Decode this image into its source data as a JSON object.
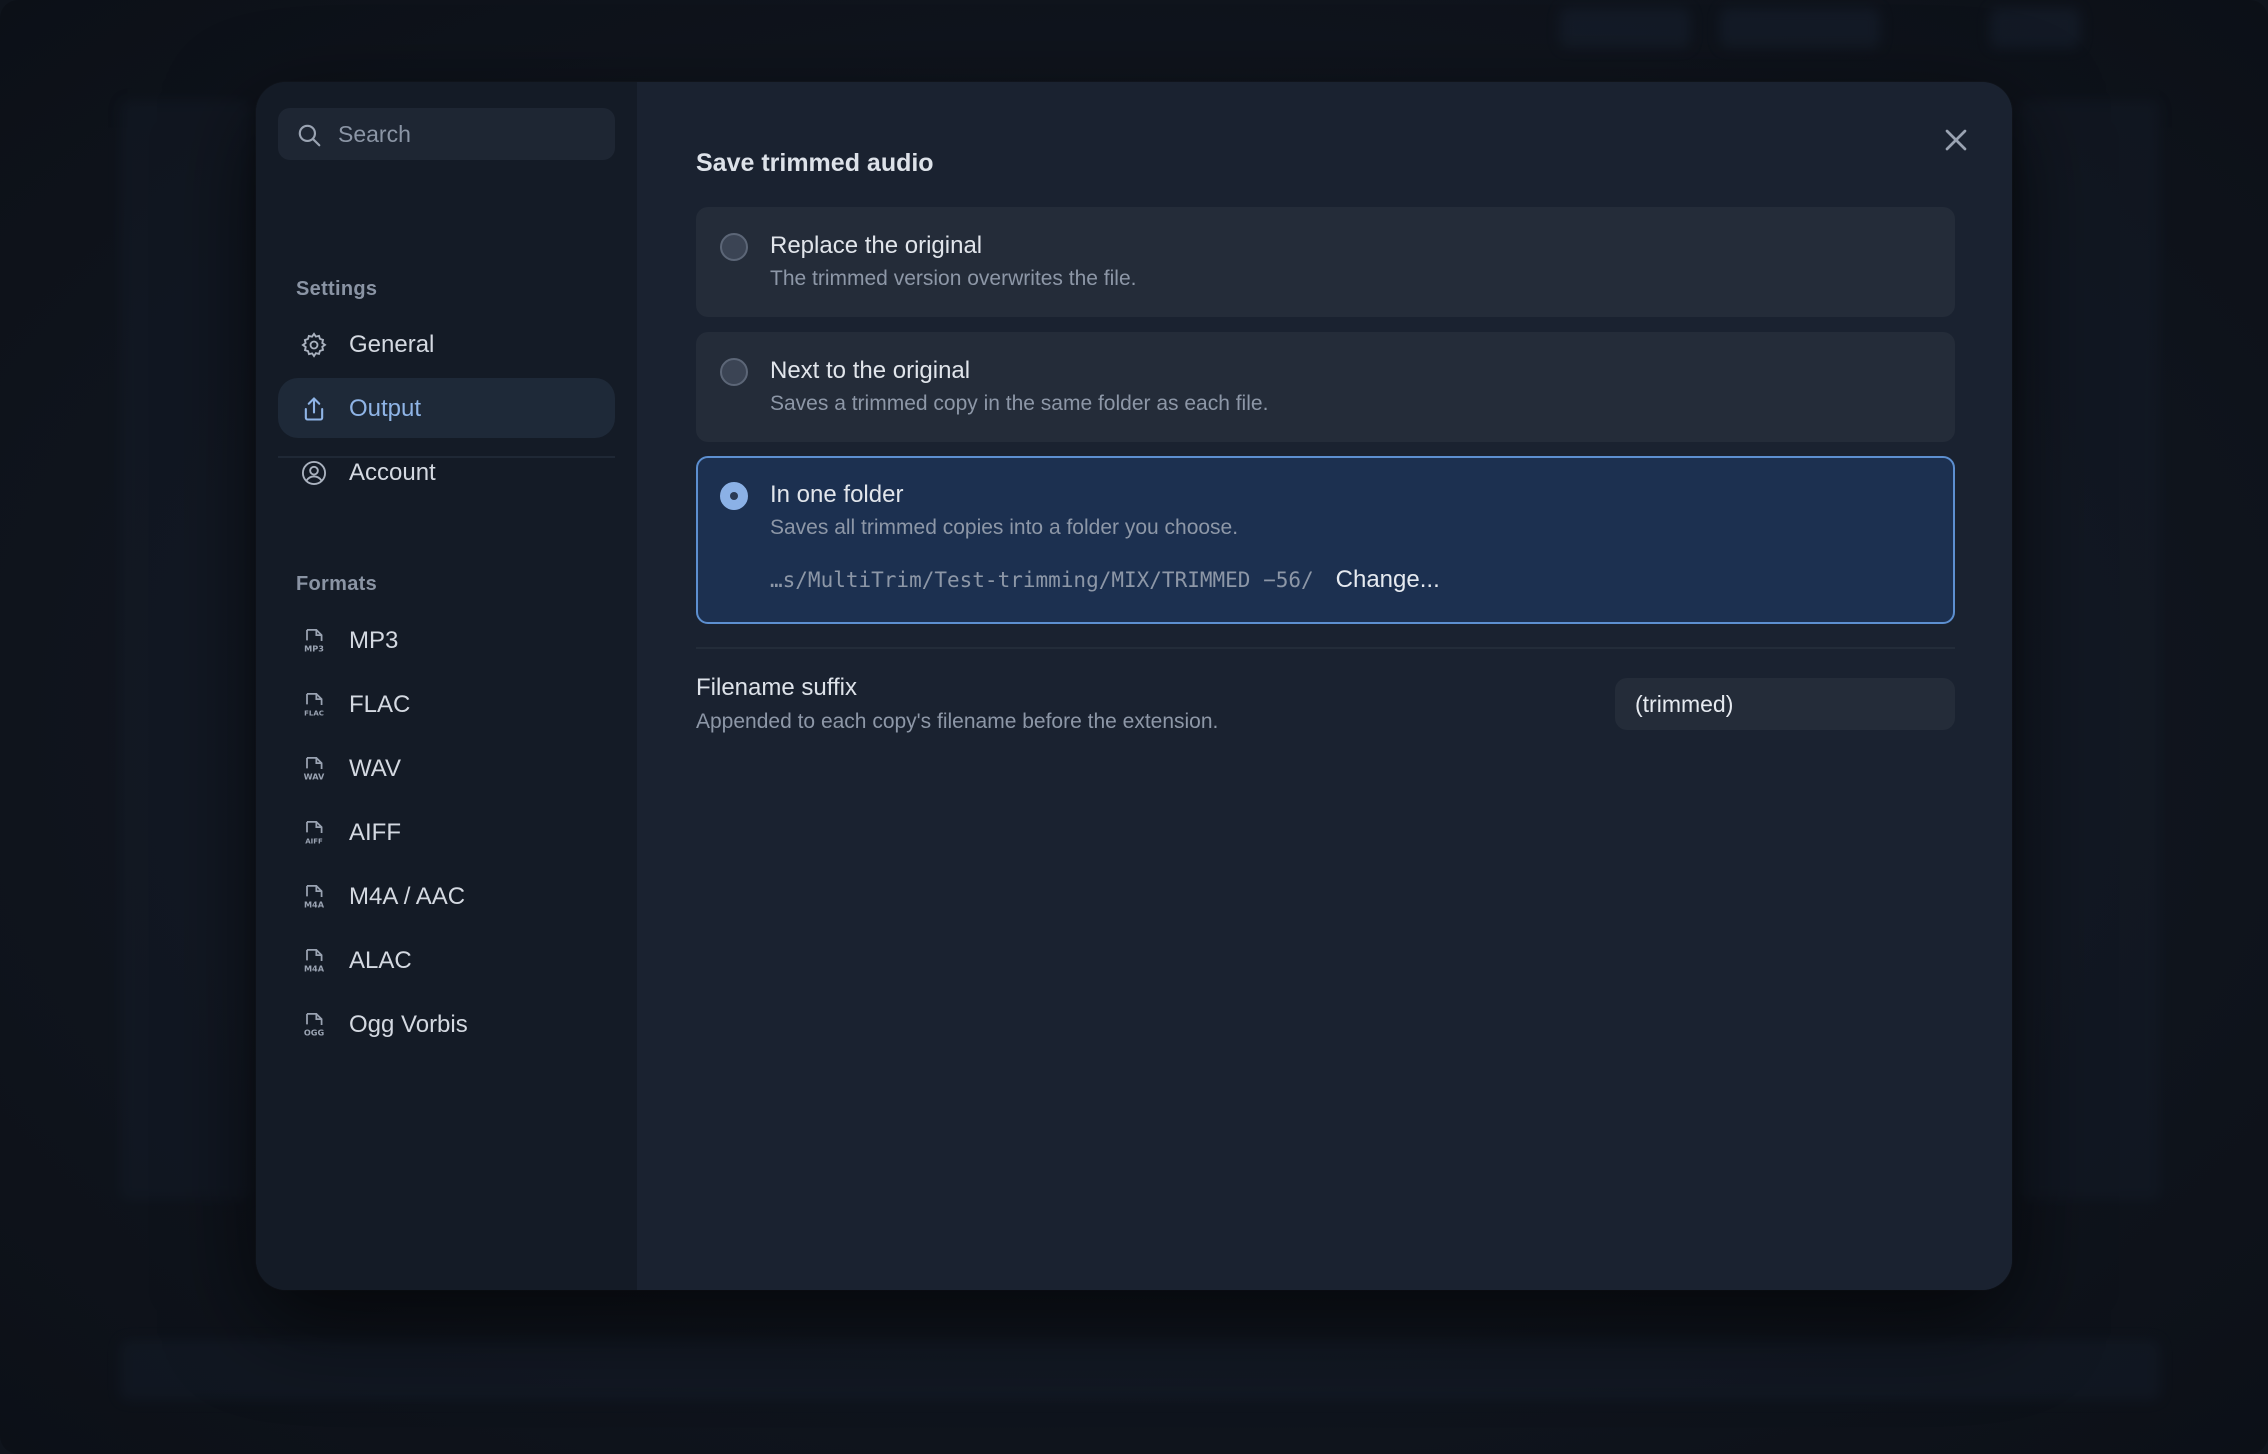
{
  "sidebar": {
    "search": {
      "placeholder": "Search",
      "icon": "search-icon"
    },
    "settings_label": "Settings",
    "settings_items": [
      {
        "label": "General",
        "icon": "gear-icon"
      },
      {
        "label": "Output",
        "icon": "share-upload-icon",
        "active": true
      },
      {
        "label": "Account",
        "icon": "user-circle-icon"
      }
    ],
    "formats_label": "Formats",
    "format_items": [
      {
        "label": "MP3",
        "icon": "mp3-file-icon",
        "badge": "MP3"
      },
      {
        "label": "FLAC",
        "icon": "flac-file-icon",
        "badge": "FLAC"
      },
      {
        "label": "WAV",
        "icon": "wav-file-icon",
        "badge": "WAV"
      },
      {
        "label": "AIFF",
        "icon": "aiff-file-icon",
        "badge": "AIFF"
      },
      {
        "label": "M4A / AAC",
        "icon": "m4a-file-icon",
        "badge": "M4A"
      },
      {
        "label": "ALAC",
        "icon": "m4a-file-icon",
        "badge": "M4A"
      },
      {
        "label": "Ogg Vorbis",
        "icon": "ogg-file-icon",
        "badge": "OGG"
      }
    ]
  },
  "main": {
    "heading": "Save trimmed audio",
    "options": [
      {
        "title": "Replace the original",
        "description": "The trimmed version overwrites the file.",
        "selected": false
      },
      {
        "title": "Next to the original",
        "description": "Saves a trimmed copy in the same folder as each file.",
        "selected": false
      },
      {
        "title": "In one folder",
        "description": "Saves all trimmed copies into a folder you choose.",
        "selected": true,
        "path": "…s/MultiTrim/Test-trimming/MIX/TRIMMED −56/",
        "change_label": "Change..."
      }
    ],
    "suffix": {
      "title": "Filename suffix",
      "description": "Appended to each copy's filename before the extension.",
      "value": "(trimmed)"
    }
  },
  "colors": {
    "accent": "#8fb4e6",
    "selected_border": "#5d8fd0",
    "dialog_bg": "#1a2230",
    "sidebar_bg": "#141b26"
  }
}
